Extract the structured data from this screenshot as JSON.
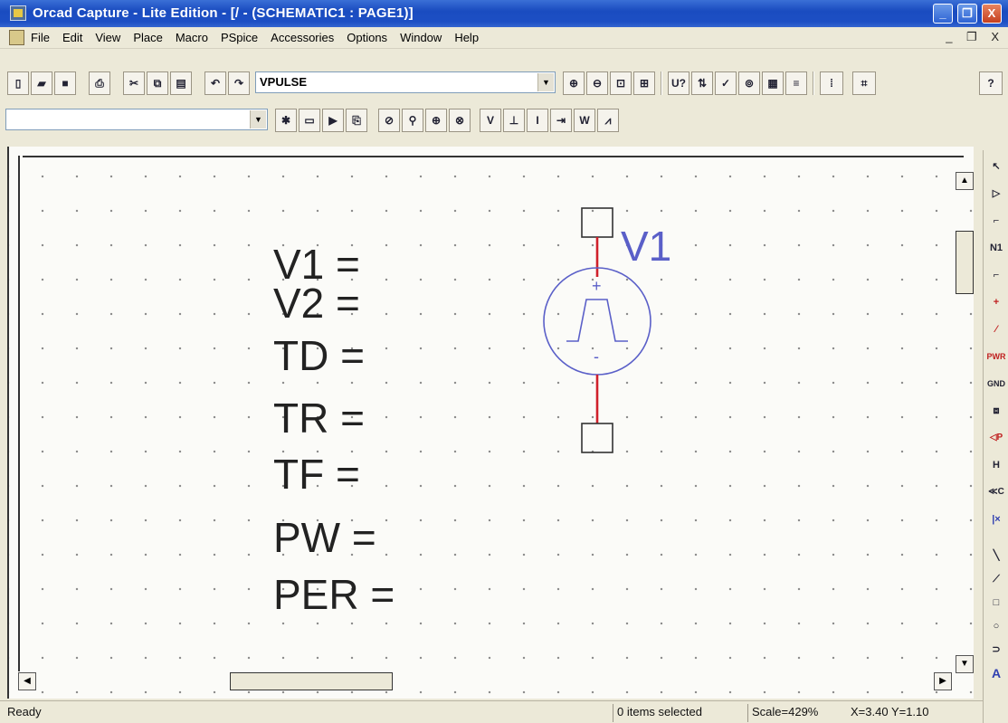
{
  "window": {
    "title": "Orcad Capture - Lite Edition - [/ - (SCHEMATIC1 : PAGE1)]",
    "minimize_glyph": "_",
    "restore_glyph": "❐",
    "close_glyph": "X"
  },
  "menu": {
    "items": [
      "File",
      "Edit",
      "View",
      "Place",
      "Macro",
      "PSpice",
      "Accessories",
      "Options",
      "Window",
      "Help"
    ],
    "mdi_controls": "_ ❐ X"
  },
  "toolbar1": {
    "part_combo_value": "VPULSE",
    "dropdown_glyph": "▼",
    "partref_label": "U?",
    "help_label": "?"
  },
  "toolbar2": {
    "combo_value": "",
    "voltage_marker": "V",
    "current_marker": "I",
    "power_marker": "W"
  },
  "schematic": {
    "part_ref": "V1",
    "plus_sign": "+",
    "minus_sign": "-",
    "params": [
      "V1 =",
      "V2 =",
      "TD =",
      "TR =",
      "TF =",
      "PW =",
      "PER ="
    ]
  },
  "palette": {
    "icons": [
      "select-arrow-icon",
      "place-part-icon",
      "wire-icon",
      "net-alias-icon",
      "bus-icon",
      "junction-icon",
      "bus-entry-icon",
      "power-icon",
      "ground-icon",
      "hierarchical-block-icon",
      "hierarchical-port-icon",
      "hierarchical-pin-icon",
      "off-page-connector-icon",
      "no-connect-icon",
      "line-icon",
      "polyline-icon",
      "rectangle-icon",
      "ellipse-icon",
      "arc-icon",
      "text-icon"
    ],
    "labels": [
      "↖",
      "▷",
      "⌐",
      "N1",
      "⌐",
      "+",
      "⁄",
      "PWR",
      "GND",
      "⧈",
      "◁P",
      "H",
      "≪C",
      "|×",
      "╲",
      "⟋",
      "□",
      "○",
      "⊃",
      "A"
    ]
  },
  "scrollbars": {
    "up_glyph": "▲",
    "down_glyph": "▼",
    "left_glyph": "◀",
    "right_glyph": "▶"
  },
  "status": {
    "ready": "Ready",
    "selection": "0 items selected",
    "scale": "Scale=429%",
    "coords": "X=3.40 Y=1.10"
  },
  "colors": {
    "titlebar": "#1d4fc4",
    "symbol": "#5a5fc8",
    "pin": "#d0202a"
  }
}
